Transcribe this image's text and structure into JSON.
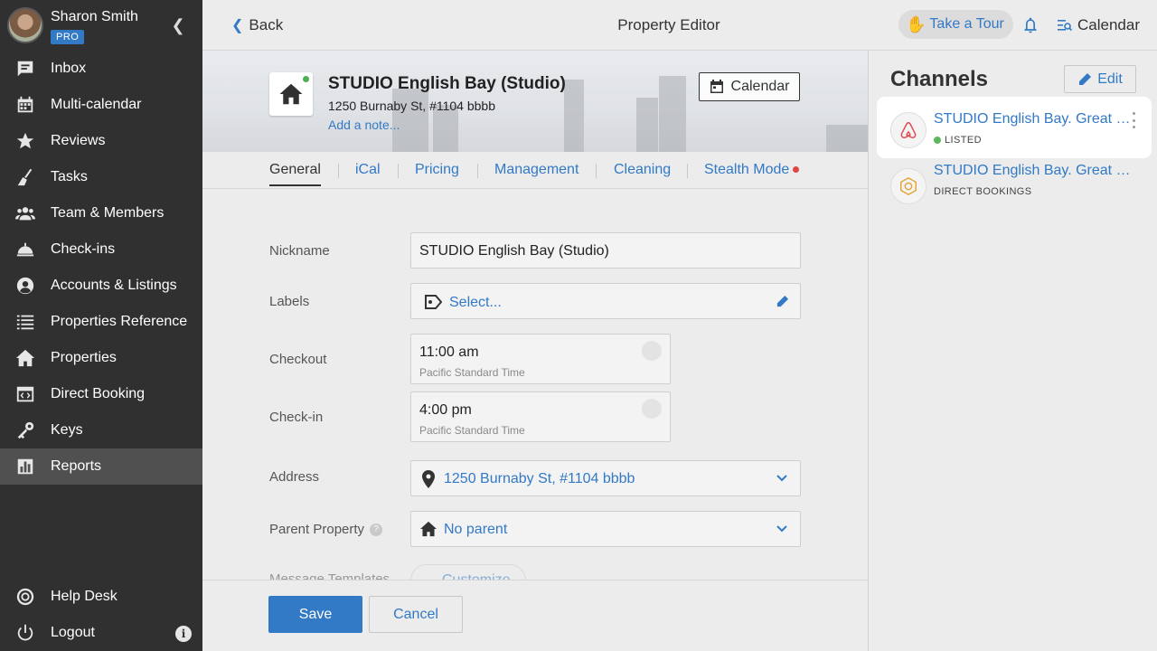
{
  "user": {
    "name": "Sharon Smith",
    "badge": "PRO"
  },
  "nav": [
    {
      "label": "Inbox",
      "icon": "inbox-icon"
    },
    {
      "label": "Multi-calendar",
      "icon": "calendar-icon"
    },
    {
      "label": "Reviews",
      "icon": "star-icon"
    },
    {
      "label": "Tasks",
      "icon": "broom-icon"
    },
    {
      "label": "Team & Members",
      "icon": "team-icon"
    },
    {
      "label": "Check-ins",
      "icon": "bell-service-icon"
    },
    {
      "label": "Accounts & Listings",
      "icon": "account-icon"
    },
    {
      "label": "Properties Reference",
      "icon": "list-icon"
    },
    {
      "label": "Properties",
      "icon": "home-icon"
    },
    {
      "label": "Direct Booking",
      "icon": "browser-code-icon"
    },
    {
      "label": "Keys",
      "icon": "key-icon"
    },
    {
      "label": "Reports",
      "icon": "report-icon",
      "active": true
    }
  ],
  "bottom_nav": [
    {
      "label": "Help Desk",
      "icon": "lifebuoy-icon"
    },
    {
      "label": "Logout",
      "icon": "power-icon"
    }
  ],
  "topbar": {
    "back": "Back",
    "title": "Property Editor",
    "tour": "Take a Tour",
    "calendar": "Calendar"
  },
  "property": {
    "title": "STUDIO English Bay (Studio)",
    "address": "1250 Burnaby St, #1104 bbbb",
    "add_note": "Add a note...",
    "calendar_button": "Calendar"
  },
  "tabs": [
    "General",
    "iCal",
    "Pricing",
    "Management",
    "Cleaning",
    "Stealth Mode"
  ],
  "form": {
    "nickname_label": "Nickname",
    "nickname_value": "STUDIO English Bay (Studio)",
    "labels_label": "Labels",
    "labels_placeholder": "Select...",
    "checkout_label": "Checkout",
    "checkout_time": "11:00 am",
    "checkout_tz": "Pacific Standard Time",
    "checkin_label": "Check-in",
    "checkin_time": "4:00 pm",
    "checkin_tz": "Pacific Standard Time",
    "address_label": "Address",
    "address_value": "1250 Burnaby St, #1104 bbbb",
    "parent_label": "Parent Property",
    "parent_value": "No parent",
    "templates_label": "Message Templates",
    "customize": "Customize"
  },
  "footer": {
    "save": "Save",
    "cancel": "Cancel"
  },
  "channels": {
    "title": "Channels",
    "edit": "Edit",
    "items": [
      {
        "name": "STUDIO English Bay. Great Location",
        "status": "LISTED",
        "logo": "airbnb-icon"
      },
      {
        "name": "STUDIO English Bay. Great Location",
        "status": "DIRECT BOOKINGS",
        "logo": "direct-booking-icon"
      }
    ]
  },
  "colors": {
    "accent": "#3279c6",
    "sidebar": "#303030",
    "listed": "#5cb85c",
    "alert": "#e04545"
  }
}
